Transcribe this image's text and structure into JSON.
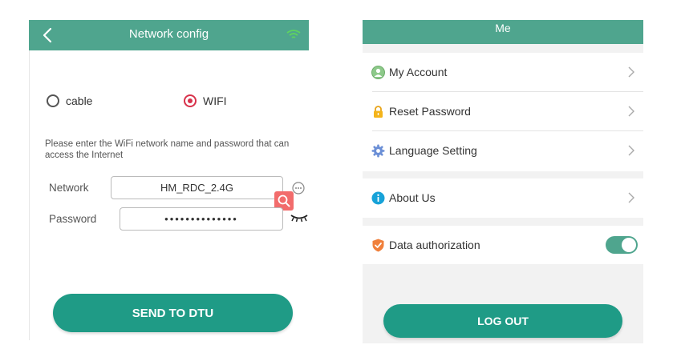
{
  "network_config": {
    "title": "Network config",
    "options": [
      {
        "label": "cable",
        "selected": false
      },
      {
        "label": "WIFI",
        "selected": true
      }
    ],
    "hint": "Please enter the WiFi network name and password that can access the Internet",
    "network": {
      "label": "Network",
      "value": "HM_RDC_2.4G"
    },
    "password": {
      "label": "Password",
      "value": "••••••••••••••"
    },
    "send_button": "SEND TO DTU"
  },
  "me": {
    "title": "Me",
    "items": [
      {
        "label": "My Account",
        "icon": "user-icon"
      },
      {
        "label": "Reset Password",
        "icon": "lock-icon"
      },
      {
        "label": "Language Setting",
        "icon": "gear-icon"
      },
      {
        "label": "About Us",
        "icon": "info-icon"
      },
      {
        "label": "Data authorization",
        "icon": "shield-check-icon",
        "toggle_on": true
      }
    ],
    "logout_button": "LOG OUT"
  },
  "colors": {
    "header": "#4fa58e",
    "button": "#1f9b86",
    "radio_selected": "#d8324b",
    "search_badge": "#f26c6c"
  }
}
